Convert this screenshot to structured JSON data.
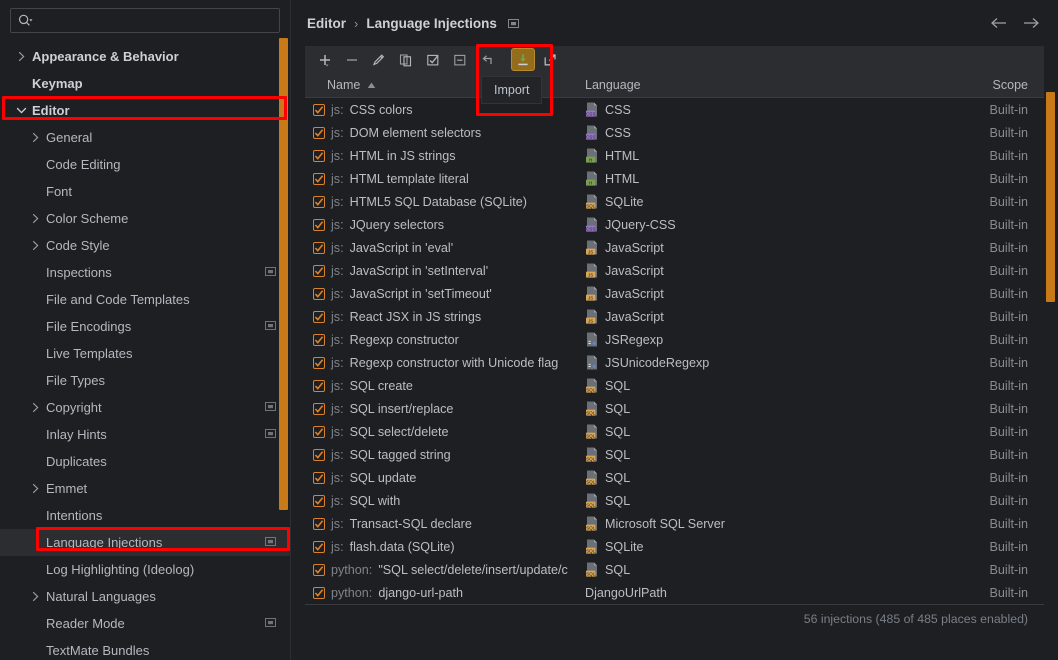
{
  "search": {
    "placeholder": "",
    "value": "",
    "icon": "search-icon"
  },
  "sidebar": {
    "items": [
      {
        "label": "Appearance & Behavior",
        "level": 1,
        "arrow": "right",
        "bold": true,
        "cfg": false,
        "selected": false
      },
      {
        "label": "Keymap",
        "level": 1,
        "arrow": "none",
        "bold": true,
        "cfg": false,
        "selected": false
      },
      {
        "label": "Editor",
        "level": 1,
        "arrow": "down",
        "bold": true,
        "cfg": false,
        "selected": false
      },
      {
        "label": "General",
        "level": 2,
        "arrow": "right",
        "bold": false,
        "cfg": false,
        "selected": false
      },
      {
        "label": "Code Editing",
        "level": 2,
        "arrow": "none",
        "bold": false,
        "cfg": false,
        "selected": false
      },
      {
        "label": "Font",
        "level": 2,
        "arrow": "none",
        "bold": false,
        "cfg": false,
        "selected": false
      },
      {
        "label": "Color Scheme",
        "level": 2,
        "arrow": "right",
        "bold": false,
        "cfg": false,
        "selected": false
      },
      {
        "label": "Code Style",
        "level": 2,
        "arrow": "right",
        "bold": false,
        "cfg": false,
        "selected": false
      },
      {
        "label": "Inspections",
        "level": 2,
        "arrow": "none",
        "bold": false,
        "cfg": true,
        "selected": false
      },
      {
        "label": "File and Code Templates",
        "level": 2,
        "arrow": "none",
        "bold": false,
        "cfg": false,
        "selected": false
      },
      {
        "label": "File Encodings",
        "level": 2,
        "arrow": "none",
        "bold": false,
        "cfg": true,
        "selected": false
      },
      {
        "label": "Live Templates",
        "level": 2,
        "arrow": "none",
        "bold": false,
        "cfg": false,
        "selected": false
      },
      {
        "label": "File Types",
        "level": 2,
        "arrow": "none",
        "bold": false,
        "cfg": false,
        "selected": false
      },
      {
        "label": "Copyright",
        "level": 2,
        "arrow": "right",
        "bold": false,
        "cfg": true,
        "selected": false
      },
      {
        "label": "Inlay Hints",
        "level": 2,
        "arrow": "none",
        "bold": false,
        "cfg": true,
        "selected": false
      },
      {
        "label": "Duplicates",
        "level": 2,
        "arrow": "none",
        "bold": false,
        "cfg": false,
        "selected": false
      },
      {
        "label": "Emmet",
        "level": 2,
        "arrow": "right",
        "bold": false,
        "cfg": false,
        "selected": false
      },
      {
        "label": "Intentions",
        "level": 2,
        "arrow": "none",
        "bold": false,
        "cfg": false,
        "selected": false
      },
      {
        "label": "Language Injections",
        "level": 2,
        "arrow": "none",
        "bold": false,
        "cfg": true,
        "selected": true
      },
      {
        "label": "Log Highlighting (Ideolog)",
        "level": 2,
        "arrow": "none",
        "bold": false,
        "cfg": false,
        "selected": false
      },
      {
        "label": "Natural Languages",
        "level": 2,
        "arrow": "right",
        "bold": false,
        "cfg": false,
        "selected": false
      },
      {
        "label": "Reader Mode",
        "level": 2,
        "arrow": "none",
        "bold": false,
        "cfg": true,
        "selected": false
      },
      {
        "label": "TextMate Bundles",
        "level": 2,
        "arrow": "none",
        "bold": false,
        "cfg": false,
        "selected": false
      }
    ]
  },
  "header": {
    "breadcrumb_root": "Editor",
    "breadcrumb_sep": "›",
    "breadcrumb_current": "Language Injections",
    "back_icon": "arrow-left-icon",
    "forward_icon": "arrow-right-icon"
  },
  "toolbar": {
    "buttons": [
      {
        "name": "add-button",
        "icon": "plus-icon",
        "active": false
      },
      {
        "name": "remove-button",
        "icon": "minus-icon",
        "active": false
      },
      {
        "name": "edit-button",
        "icon": "pencil-icon",
        "active": false
      },
      {
        "name": "duplicate-button",
        "icon": "copy-icon",
        "active": false
      },
      {
        "name": "enable-all-button",
        "icon": "checkbox-icon",
        "active": false
      },
      {
        "name": "disable-all-button",
        "icon": "minus-box-icon",
        "active": false
      },
      {
        "name": "revert-button",
        "icon": "revert-icon",
        "active": false
      },
      {
        "name": "import-button",
        "icon": "import-icon",
        "active": true
      },
      {
        "name": "export-button",
        "icon": "export-icon",
        "active": false
      }
    ],
    "tooltip": "Import"
  },
  "table": {
    "columns": {
      "name": "Name",
      "language": "Language",
      "scope": "Scope"
    },
    "sort_indicator": "ascending",
    "rows": [
      {
        "checked": true,
        "prefix": "js:",
        "name": "CSS colors",
        "language": "CSS",
        "lang_icon": "css",
        "scope": "Built-in"
      },
      {
        "checked": true,
        "prefix": "js:",
        "name": "DOM element selectors",
        "language": "CSS",
        "lang_icon": "css",
        "scope": "Built-in"
      },
      {
        "checked": true,
        "prefix": "js:",
        "name": "HTML in JS strings",
        "language": "HTML",
        "lang_icon": "html",
        "scope": "Built-in"
      },
      {
        "checked": true,
        "prefix": "js:",
        "name": "HTML template literal",
        "language": "HTML",
        "lang_icon": "html",
        "scope": "Built-in"
      },
      {
        "checked": true,
        "prefix": "js:",
        "name": "HTML5 SQL Database (SQLite)",
        "language": "SQLite",
        "lang_icon": "sql",
        "scope": "Built-in"
      },
      {
        "checked": true,
        "prefix": "js:",
        "name": "JQuery selectors",
        "language": "JQuery-CSS",
        "lang_icon": "css",
        "scope": "Built-in"
      },
      {
        "checked": true,
        "prefix": "js:",
        "name": "JavaScript in 'eval'",
        "language": "JavaScript",
        "lang_icon": "js",
        "scope": "Built-in"
      },
      {
        "checked": true,
        "prefix": "js:",
        "name": "JavaScript in 'setInterval'",
        "language": "JavaScript",
        "lang_icon": "js",
        "scope": "Built-in"
      },
      {
        "checked": true,
        "prefix": "js:",
        "name": "JavaScript in 'setTimeout'",
        "language": "JavaScript",
        "lang_icon": "js",
        "scope": "Built-in"
      },
      {
        "checked": true,
        "prefix": "js:",
        "name": "React JSX in JS strings",
        "language": "JavaScript",
        "lang_icon": "js",
        "scope": "Built-in"
      },
      {
        "checked": true,
        "prefix": "js:",
        "name": "Regexp constructor",
        "language": "JSRegexp",
        "lang_icon": "regex",
        "scope": "Built-in"
      },
      {
        "checked": true,
        "prefix": "js:",
        "name": "Regexp constructor with Unicode flag",
        "language": "JSUnicodeRegexp",
        "lang_icon": "regex",
        "scope": "Built-in"
      },
      {
        "checked": true,
        "prefix": "js:",
        "name": "SQL create",
        "language": "SQL",
        "lang_icon": "sql",
        "scope": "Built-in"
      },
      {
        "checked": true,
        "prefix": "js:",
        "name": "SQL insert/replace",
        "language": "SQL",
        "lang_icon": "sql",
        "scope": "Built-in"
      },
      {
        "checked": true,
        "prefix": "js:",
        "name": "SQL select/delete",
        "language": "SQL",
        "lang_icon": "sql",
        "scope": "Built-in"
      },
      {
        "checked": true,
        "prefix": "js:",
        "name": "SQL tagged string",
        "language": "SQL",
        "lang_icon": "sql",
        "scope": "Built-in"
      },
      {
        "checked": true,
        "prefix": "js:",
        "name": "SQL update",
        "language": "SQL",
        "lang_icon": "sql",
        "scope": "Built-in"
      },
      {
        "checked": true,
        "prefix": "js:",
        "name": "SQL with",
        "language": "SQL",
        "lang_icon": "sql",
        "scope": "Built-in"
      },
      {
        "checked": true,
        "prefix": "js:",
        "name": "Transact-SQL declare",
        "language": "Microsoft SQL Server",
        "lang_icon": "sql",
        "scope": "Built-in"
      },
      {
        "checked": true,
        "prefix": "js:",
        "name": "flash.data (SQLite)",
        "language": "SQLite",
        "lang_icon": "sql",
        "scope": "Built-in"
      },
      {
        "checked": true,
        "prefix": "python:",
        "name": "\"SQL select/delete/insert/update/c",
        "language": "SQL",
        "lang_icon": "sql",
        "scope": "Built-in"
      },
      {
        "checked": true,
        "prefix": "python:",
        "name": "django-url-path",
        "language": "DjangoUrlPath",
        "lang_icon": "none",
        "scope": "Built-in"
      }
    ],
    "status": "56 injections (485 of 485 places enabled)"
  },
  "colors": {
    "background": "#1e1f22",
    "panel": "#2b2d30",
    "accent_scrollbar": "#c87a18",
    "highlight_border": "#ff0000",
    "checkbox": "#d9822b",
    "text": "#bcbec4",
    "text_dim": "#868a91"
  }
}
